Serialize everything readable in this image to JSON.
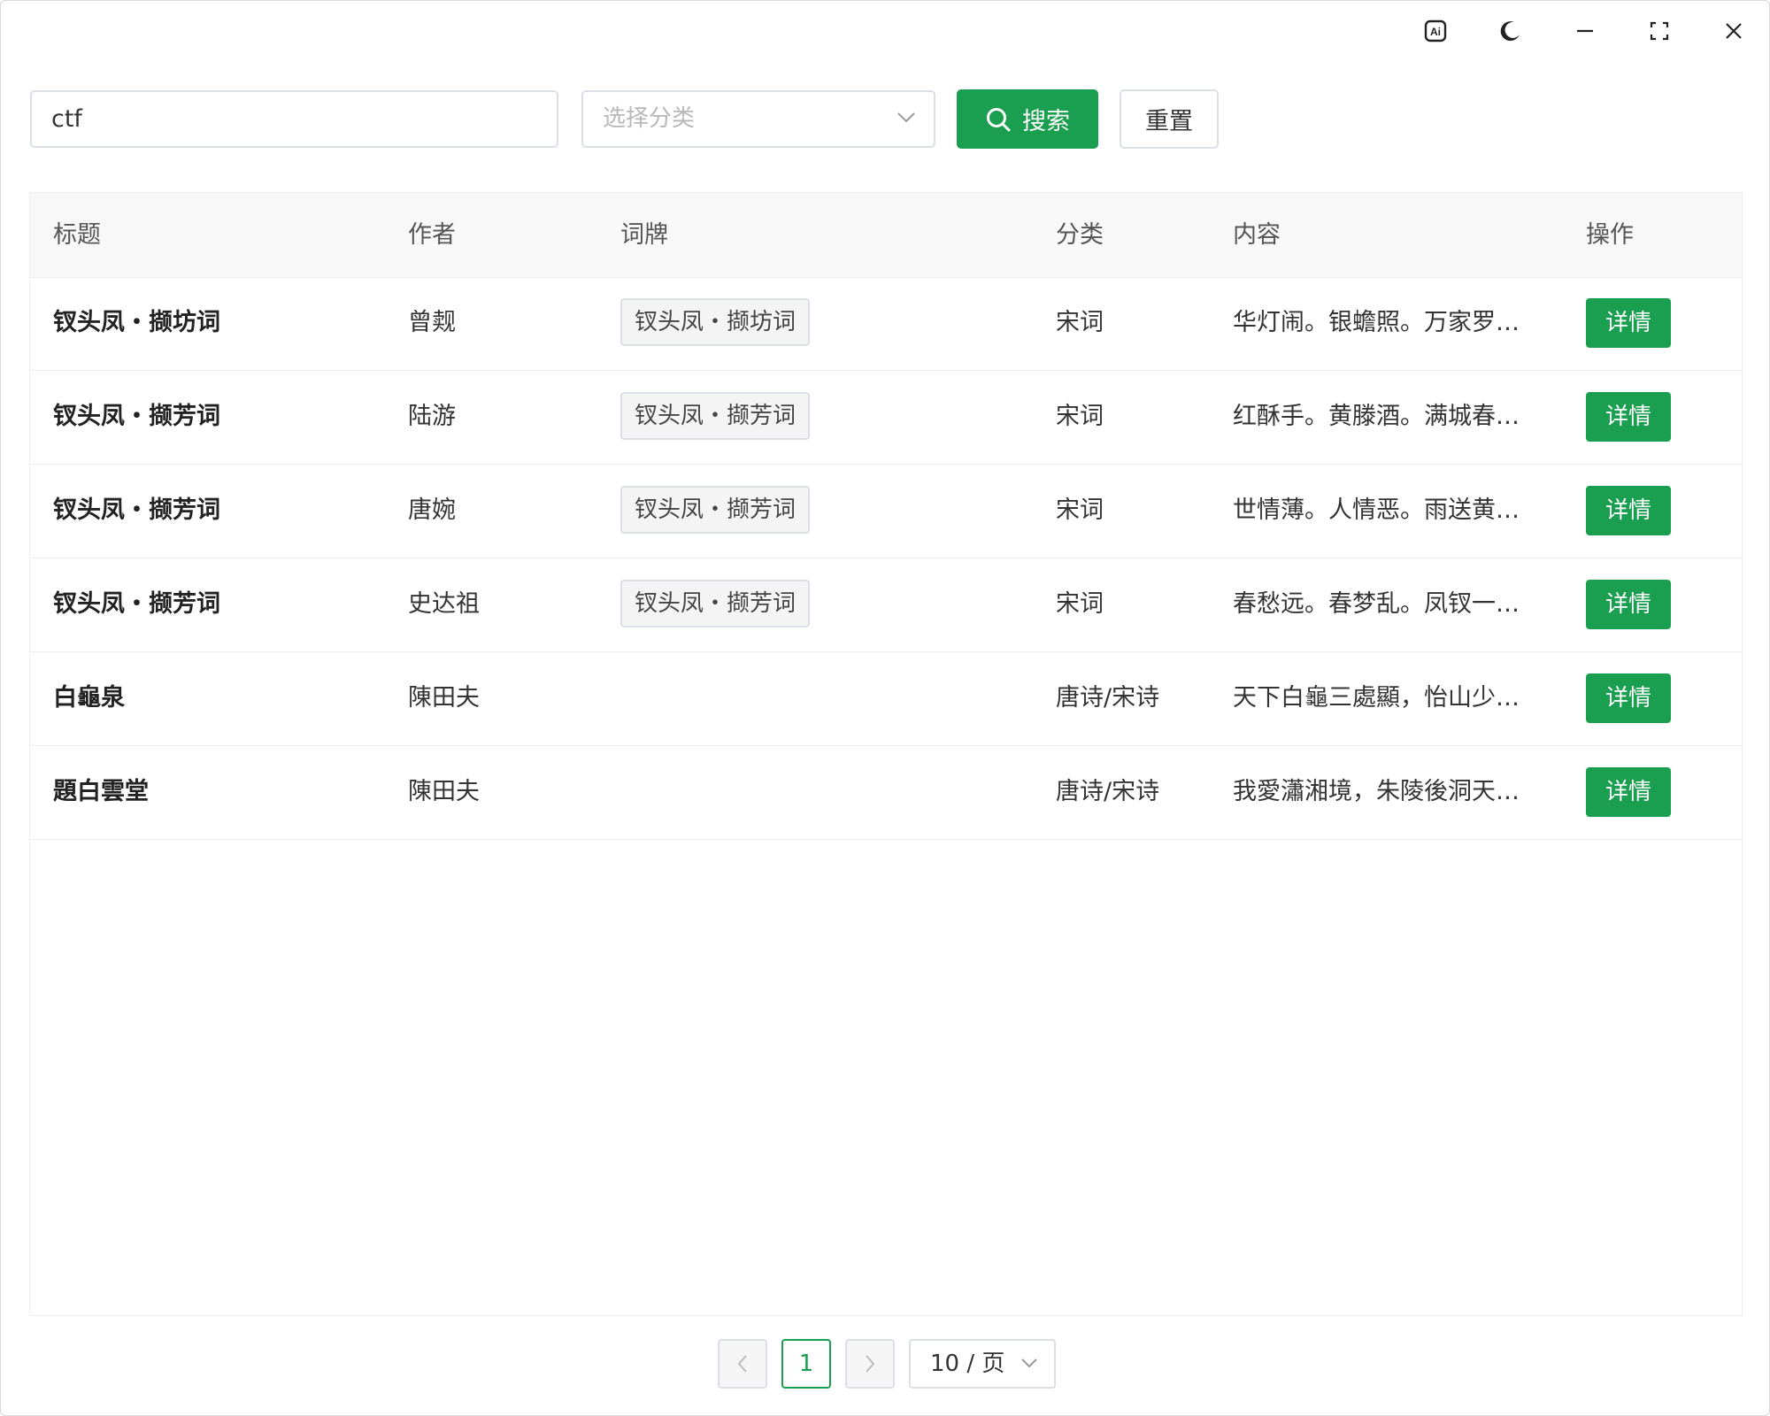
{
  "titlebar": {
    "icons": [
      "ai-icon",
      "moon-icon",
      "minimize-icon",
      "fullscreen-icon",
      "close-icon"
    ]
  },
  "search": {
    "value": "ctf",
    "category_placeholder": "选择分类",
    "search_label": "搜索",
    "reset_label": "重置"
  },
  "table": {
    "headers": [
      "标题",
      "作者",
      "词牌",
      "分类",
      "内容",
      "操作"
    ],
    "rows": [
      {
        "title": "钗头凤・撷坊词",
        "author": "曾觌",
        "cipai": "钗头凤・撷坊词",
        "category": "宋词",
        "content": "华灯闹。银蟾照。万家罗…",
        "action": "详情"
      },
      {
        "title": "钗头凤・撷芳词",
        "author": "陆游",
        "cipai": "钗头凤・撷芳词",
        "category": "宋词",
        "content": "红酥手。黄滕酒。满城春…",
        "action": "详情"
      },
      {
        "title": "钗头凤・撷芳词",
        "author": "唐婉",
        "cipai": "钗头凤・撷芳词",
        "category": "宋词",
        "content": "世情薄。人情恶。雨送黄…",
        "action": "详情"
      },
      {
        "title": "钗头凤・撷芳词",
        "author": "史达祖",
        "cipai": "钗头凤・撷芳词",
        "category": "宋词",
        "content": "春愁远。春梦乱。凤钗一…",
        "action": "详情"
      },
      {
        "title": "白龜泉",
        "author": "陳田夫",
        "cipai": "",
        "category": "唐诗/宋诗",
        "content": "天下白龜三處顯，怡山少…",
        "action": "详情"
      },
      {
        "title": "題白雲堂",
        "author": "陳田夫",
        "cipai": "",
        "category": "唐诗/宋诗",
        "content": "我愛瀟湘境，朱陵後洞天…",
        "action": "详情"
      }
    ]
  },
  "pagination": {
    "current_page": "1",
    "page_size": "10 / 页"
  },
  "colors": {
    "primary": "#1a9e4f",
    "header_bg": "#f8f8f9",
    "border": "#dcdfe6"
  }
}
